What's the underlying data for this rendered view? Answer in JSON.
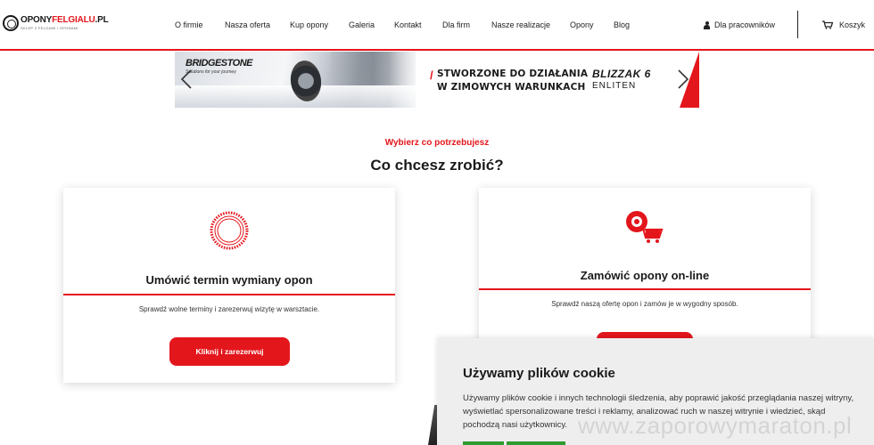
{
  "header": {
    "logo_dark": "OPONY",
    "logo_red": "FELGIALU",
    "logo_tld": ".PL",
    "logo_tagline": "SKLEP Z FELGAMI I OPONAMI",
    "nav": [
      {
        "label": "O firmie"
      },
      {
        "label": "Nasza oferta"
      },
      {
        "label": "Kup opony"
      },
      {
        "label": "Galeria"
      },
      {
        "label": "Kontakt"
      },
      {
        "label": "Dla firm"
      },
      {
        "label": "Nasze realizacje"
      },
      {
        "label": "Opony"
      },
      {
        "label": "Blog"
      }
    ],
    "employee_label": "Dla pracowników",
    "cart_label": "Koszyk"
  },
  "banner": {
    "brand": "BRIDGESTONE",
    "brand_tagline": "Solutions for your journey",
    "headline_line1": "STWORZONE DO DZIAŁANIA",
    "headline_line2": "W ZIMOWYCH WARUNKACH",
    "product": "BLIZZAK 6",
    "product_sub": "ENLITEN",
    "accent": "#e3161c"
  },
  "section": {
    "subtitle": "Wybierz co potrzebujesz",
    "title": "Co chcesz zrobić?"
  },
  "cards": [
    {
      "icon": "tire-icon",
      "title": "Umówić termin wymiany opon",
      "text": "Sprawdź wolne terminy i zarezerwuj wizytę w warsztacie.",
      "button": "Kliknij i zarezerwuj"
    },
    {
      "icon": "tire-cart-icon",
      "title": "Zamówić opony on-line",
      "text": "Sprawdź naszą ofertę opon i zamów je w wygodny sposób.",
      "button": ""
    }
  ],
  "cookie": {
    "title": "Używamy plików cookie",
    "text": "Używamy plików cookie i innych technologii śledzenia, aby poprawić jakość przeglądania naszej witryny, wyświetlać spersonalizowane treści i reklamy, analizować ruch w naszej witrynie i wiedzieć, skąd pochodzą nasi użytkownicy."
  },
  "watermark": "www.zaporowymaraton.pl",
  "colors": {
    "accent": "#e3161c",
    "cookie_button": "#2e9c2e"
  }
}
